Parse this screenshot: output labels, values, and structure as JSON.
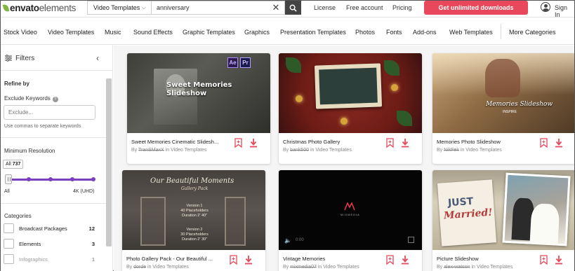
{
  "brand": {
    "name": "envato",
    "product": "elements",
    "accent": "#82b541"
  },
  "search": {
    "category": "Video Templates",
    "query": "anniversary",
    "clear_icon": "close-icon",
    "button_icon": "search-icon"
  },
  "topnav": {
    "license": "License",
    "free_account": "Free account",
    "pricing": "Pricing",
    "cta": "Get unlimited downloads",
    "cta_color": "#e9475b",
    "signin": "Sign In"
  },
  "catnav": {
    "items": [
      "Stock Video",
      "Video Templates",
      "Music",
      "Sound Effects",
      "Graphic Templates",
      "Graphics",
      "Presentation Templates",
      "Photos",
      "Fonts",
      "Add-ons",
      "Web Templates"
    ],
    "more": "More Categories"
  },
  "sidebar": {
    "title": "Filters",
    "refine_by": "Refine by",
    "exclude_label": "Exclude Keywords",
    "exclude_placeholder": "Exclude...",
    "exclude_hint": "Use commas to separate keywords",
    "resolution_label": "Minimum Resolution",
    "resolution_value": "All",
    "resolution_count": "737",
    "resolution_min": "All",
    "resolution_max": "4K (UHD)",
    "slider_accent": "#7b3fbf",
    "categories_label": "Categories",
    "categories": [
      {
        "label": "Broadcast Packages",
        "count": "12"
      },
      {
        "label": "Elements",
        "count": "3"
      },
      {
        "label": "Infographics",
        "count": "1"
      }
    ]
  },
  "cards": [
    {
      "title": "Sweet Memories Cinematic Slidesh...",
      "by": "By",
      "author": "TranSMaxX",
      "in": "in Video Templates",
      "overlay": [
        "Sweet Memories",
        "Slideshow"
      ],
      "badges": [
        "Ae",
        "Pr"
      ]
    },
    {
      "title": "Christmas Photo Gallery",
      "by": "By",
      "author": "bank500",
      "in": "in Video Templates"
    },
    {
      "title": "Memories Photo Slideshow",
      "by": "By",
      "author": "NikFek",
      "in": "in Video Templates",
      "overlay": [
        "Memories Slideshow",
        "INSPIRE"
      ]
    },
    {
      "title": "Photo Gallery Pack - Our Beautiful ...",
      "by": "By",
      "author": "dorde",
      "in": "in Video Templates",
      "overlay": [
        "Our Beautiful Moments",
        "Gallery Pack",
        "Version 1",
        "40 Placeholders",
        "Duration 2' 40\"",
        "Version 2",
        "30 Placeholders",
        "Duration 2' 30\""
      ]
    },
    {
      "title": "Vintage Memories",
      "by": "By",
      "author": "mixmedia07",
      "in": "in Video Templates",
      "overlay": [
        "MIXMEDIA",
        "0:00"
      ]
    },
    {
      "title": "Picture Slideshow",
      "by": "By",
      "author": "alex-watson",
      "in": "in Video Templates",
      "overlay": [
        "JUST",
        "Married!"
      ]
    }
  ],
  "card_icons": {
    "bookmark": "bookmark-icon",
    "download": "download-icon",
    "color": "#e9475b"
  }
}
